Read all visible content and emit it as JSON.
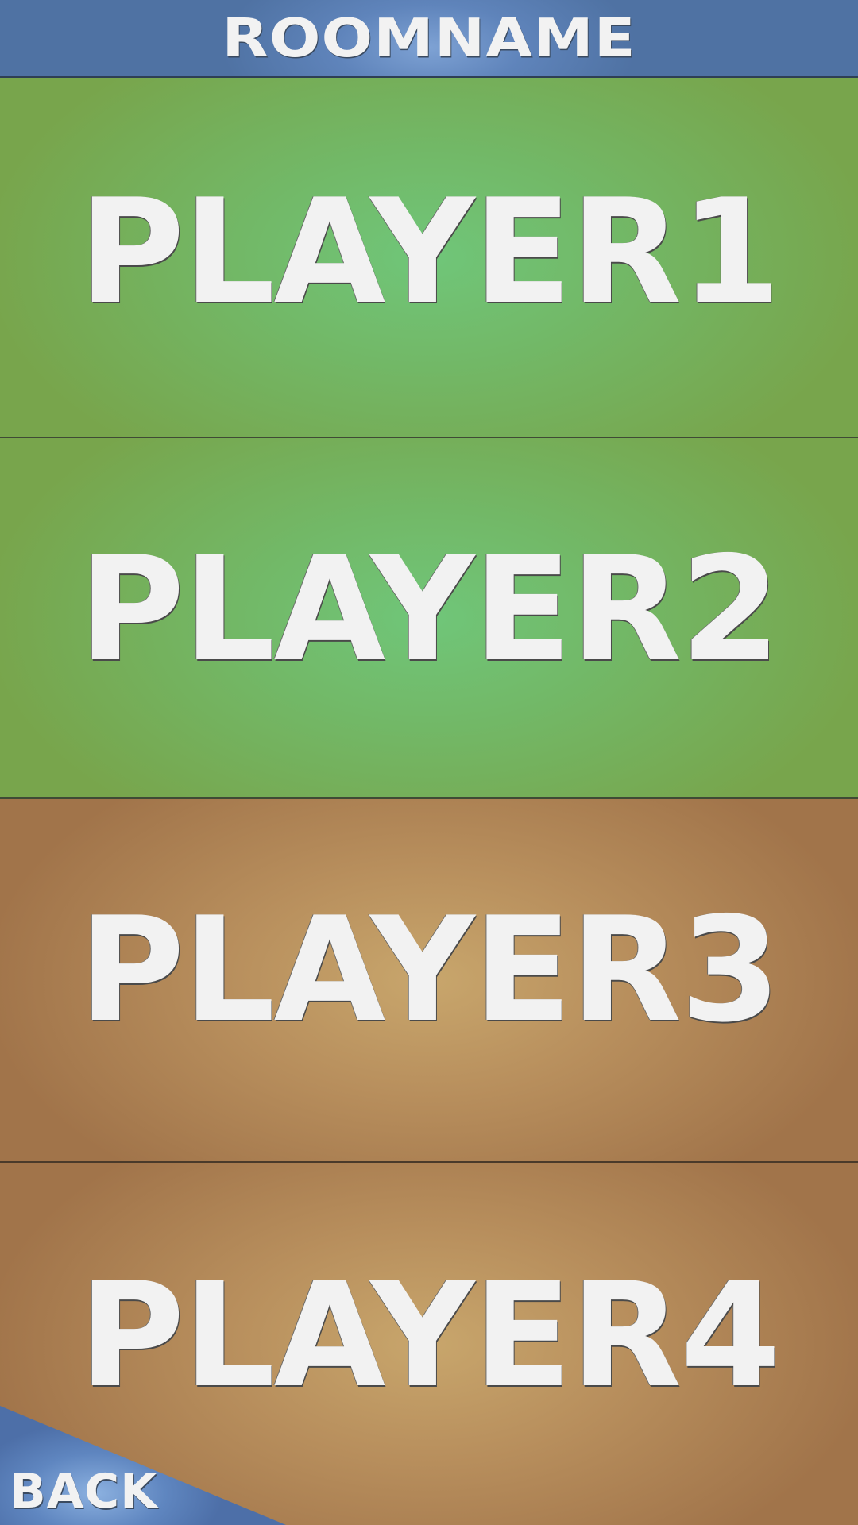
{
  "header": {
    "room_name": "ROOMNAME",
    "color": "#5f84bb"
  },
  "players": [
    {
      "label": "PLAYER1",
      "team_color": "#72b968"
    },
    {
      "label": "PLAYER2",
      "team_color": "#72b968"
    },
    {
      "label": "PLAYER3",
      "team_color": "#b88f5d"
    },
    {
      "label": "PLAYER4",
      "team_color": "#b88f5d"
    }
  ],
  "back_button": {
    "label": "BACK",
    "color": "#5f86c0"
  }
}
